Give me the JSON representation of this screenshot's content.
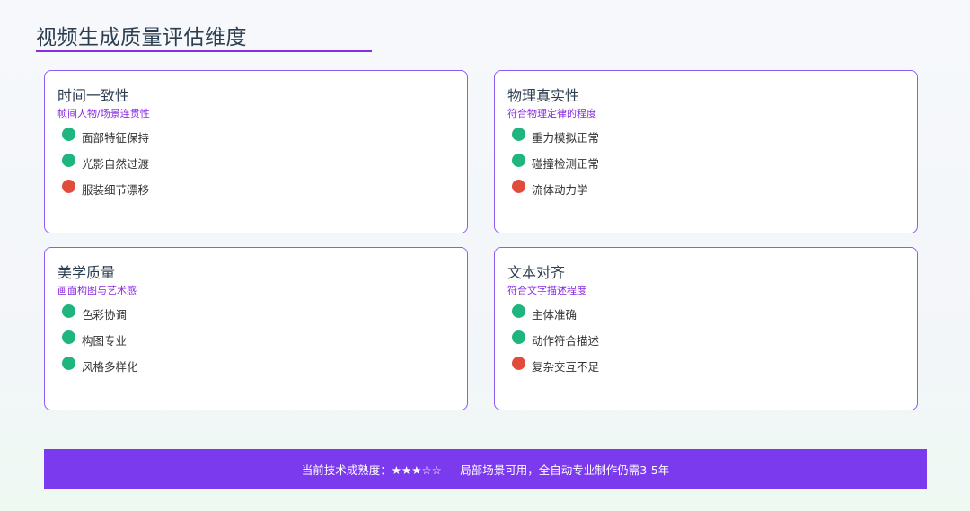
{
  "page": {
    "title": "视频生成质量评估维度"
  },
  "colors": {
    "accent": "#8a2be2",
    "card_border": "#8b5cf6",
    "ok": "#1fb57f",
    "bad": "#e14b3b",
    "banner": "#7b3aed"
  },
  "cards": [
    {
      "title": "时间一致性",
      "subtitle": "帧间人物/场景连贯性",
      "items": [
        {
          "label": "面部特征保持",
          "status": "ok"
        },
        {
          "label": "光影自然过渡",
          "status": "ok"
        },
        {
          "label": "服装细节漂移",
          "status": "bad"
        }
      ]
    },
    {
      "title": "物理真实性",
      "subtitle": "符合物理定律的程度",
      "items": [
        {
          "label": "重力模拟正常",
          "status": "ok"
        },
        {
          "label": "碰撞检测正常",
          "status": "ok"
        },
        {
          "label": "流体动力学",
          "status": "bad"
        }
      ]
    },
    {
      "title": "美学质量",
      "subtitle": "画面构图与艺术感",
      "items": [
        {
          "label": "色彩协调",
          "status": "ok"
        },
        {
          "label": "构图专业",
          "status": "ok"
        },
        {
          "label": "风格多样化",
          "status": "ok"
        }
      ]
    },
    {
      "title": "文本对齐",
      "subtitle": "符合文字描述程度",
      "items": [
        {
          "label": "主体准确",
          "status": "ok"
        },
        {
          "label": "动作符合描述",
          "status": "ok"
        },
        {
          "label": "复杂交互不足",
          "status": "bad"
        }
      ]
    }
  ],
  "footer": {
    "text": "当前技术成熟度：★★★☆☆ — 局部场景可用，全自动专业制作仍需3-5年"
  }
}
